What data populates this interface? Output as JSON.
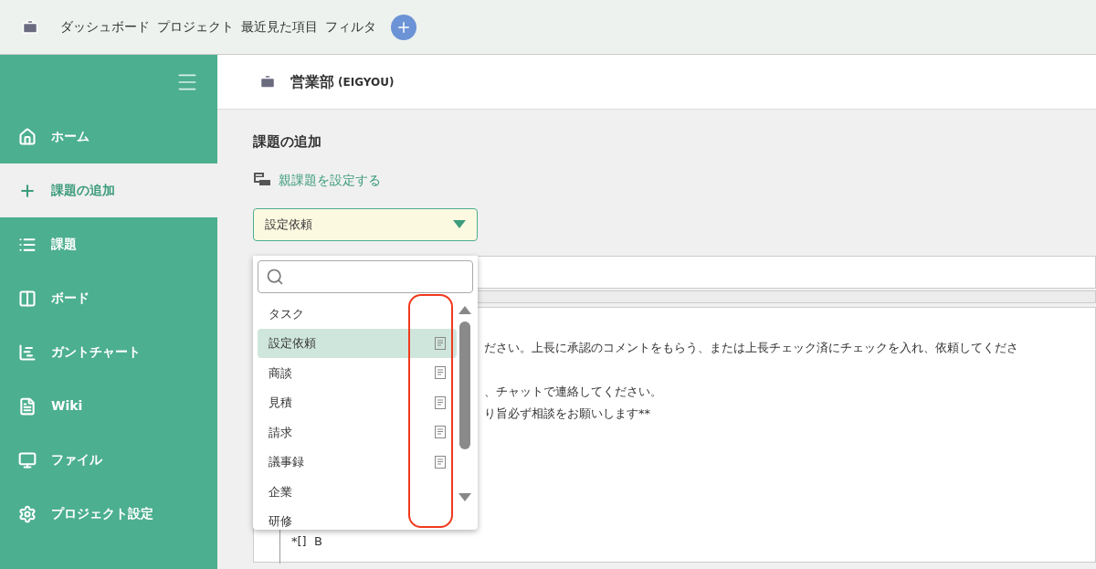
{
  "top_nav": {
    "items": [
      "ダッシュボード",
      "プロジェクト",
      "最近見た項目",
      "フィルタ"
    ]
  },
  "sidebar": {
    "items": [
      {
        "label": "ホーム",
        "selected": false
      },
      {
        "label": "課題の追加",
        "selected": true
      },
      {
        "label": "課題",
        "selected": false
      },
      {
        "label": "ボード",
        "selected": false
      },
      {
        "label": "ガントチャート",
        "selected": false
      },
      {
        "label": "Wiki",
        "selected": false
      },
      {
        "label": "ファイル",
        "selected": false
      },
      {
        "label": "プロジェクト設定",
        "selected": false
      }
    ]
  },
  "project": {
    "name": "営業部",
    "key": "(EIGYOU)"
  },
  "page_title": "課題の追加",
  "parent_link": "親課題を設定する",
  "issue_type": {
    "value": "設定依頼",
    "options": [
      {
        "label": "タスク",
        "selected": false,
        "template": false
      },
      {
        "label": "設定依頼",
        "selected": true,
        "template": true
      },
      {
        "label": "商談",
        "selected": false,
        "template": true
      },
      {
        "label": "見積",
        "selected": false,
        "template": true
      },
      {
        "label": "請求",
        "selected": false,
        "template": true
      },
      {
        "label": "議事録",
        "selected": false,
        "template": true
      },
      {
        "label": "企業",
        "selected": false,
        "template": false
      },
      {
        "label": "研修",
        "selected": false,
        "template": false
      }
    ]
  },
  "description_lines": [
    {
      "kind": "hidden_start",
      "text": "ださい。上長に承認のコメントをもらう、または上長チェック済にチェックを入れ、依頼してくださ"
    },
    {
      "kind": "hidden_start",
      "text": "、チャットで連絡してください。"
    },
    {
      "kind": "hidden_start",
      "text": "り旨必ず相談をお願いします**"
    },
    {
      "kind": "checklist",
      "text": "*[]  B"
    }
  ]
}
